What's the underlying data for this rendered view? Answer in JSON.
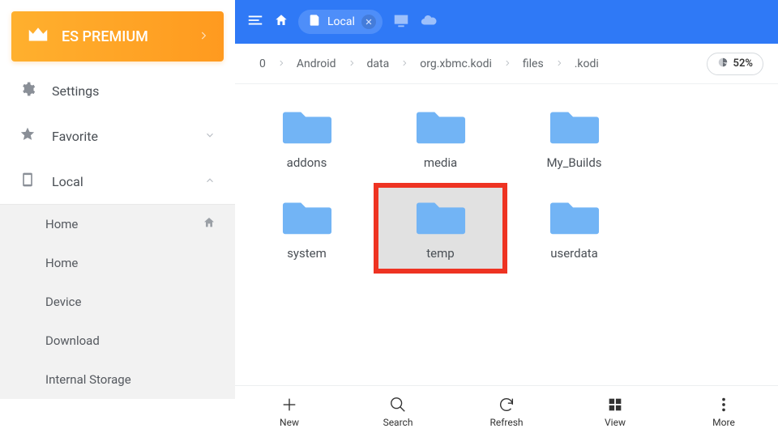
{
  "premium": {
    "label": "ES PREMIUM"
  },
  "sidebar": {
    "items": [
      {
        "label": "Settings"
      },
      {
        "label": "Favorite"
      },
      {
        "label": "Local"
      }
    ],
    "sub_items": [
      {
        "label": "Home"
      },
      {
        "label": "Home"
      },
      {
        "label": "Device"
      },
      {
        "label": "Download"
      },
      {
        "label": "Internal Storage"
      }
    ]
  },
  "topbar": {
    "chip_label": "Local"
  },
  "breadcrumbs": [
    "0",
    "Android",
    "data",
    "org.xbmc.kodi",
    "files",
    ".kodi"
  ],
  "storage": {
    "percent": "52%"
  },
  "folders": [
    {
      "label": "addons"
    },
    {
      "label": "media"
    },
    {
      "label": "My_Builds"
    },
    {
      "label": "system"
    },
    {
      "label": "temp"
    },
    {
      "label": "userdata"
    }
  ],
  "bottom": {
    "new": "New",
    "search": "Search",
    "refresh": "Refresh",
    "view": "View",
    "more": "More"
  }
}
